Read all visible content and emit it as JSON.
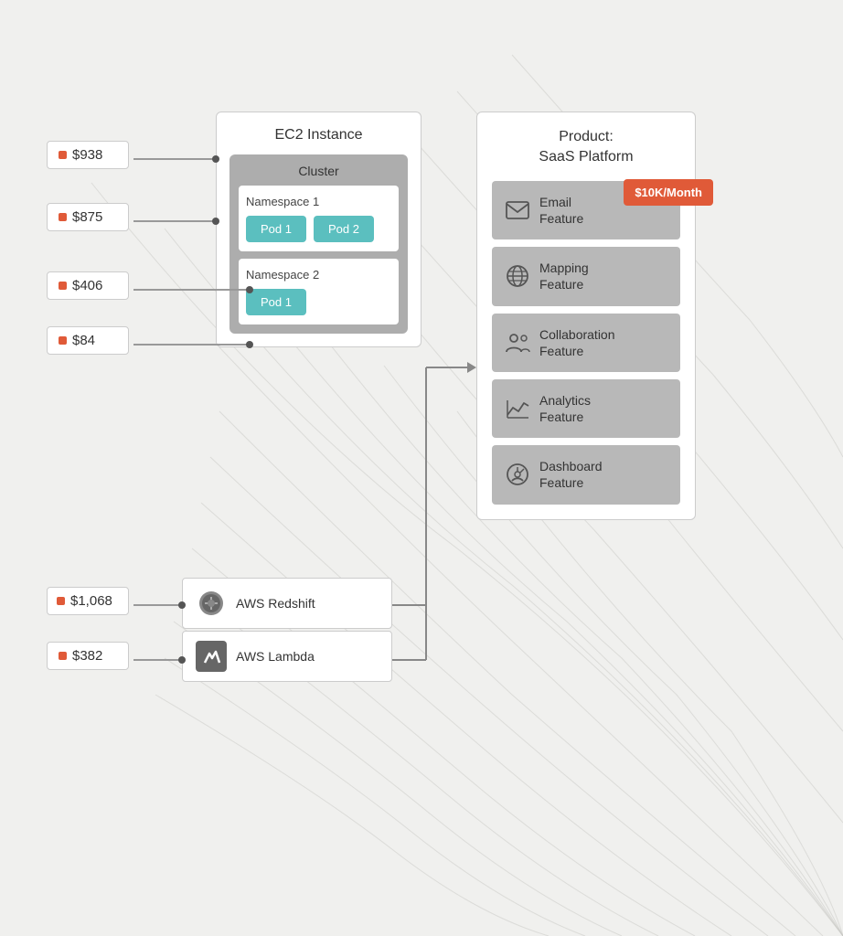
{
  "background": {
    "color": "#f0f0ee"
  },
  "ec2": {
    "title": "EC2 Instance",
    "cluster": {
      "label": "Cluster",
      "namespace1": {
        "label": "Namespace 1",
        "pods": [
          "Pod 1",
          "Pod 2"
        ]
      },
      "namespace2": {
        "label": "Namespace 2",
        "pods": [
          "Pod 1"
        ]
      }
    }
  },
  "services": [
    {
      "name": "AWS Redshift",
      "icon": "redshift"
    },
    {
      "name": "AWS Lambda",
      "icon": "lambda"
    }
  ],
  "costs_top": [
    {
      "value": "$938"
    },
    {
      "value": "$875"
    },
    {
      "value": "$406"
    },
    {
      "value": "$84"
    }
  ],
  "costs_bottom": [
    {
      "value": "$1,068"
    },
    {
      "value": "$382"
    }
  ],
  "product": {
    "title": "Product:\nSaaS Platform",
    "price_badge": "$10K/Month",
    "features": [
      {
        "label": "Email\nFeature",
        "icon": "email"
      },
      {
        "label": "Mapping\nFeature",
        "icon": "globe"
      },
      {
        "label": "Collaboration\nFeature",
        "icon": "people"
      },
      {
        "label": "Analytics\nFeature",
        "icon": "chart"
      },
      {
        "label": "Dashboard\nFeature",
        "icon": "dashboard"
      }
    ]
  }
}
